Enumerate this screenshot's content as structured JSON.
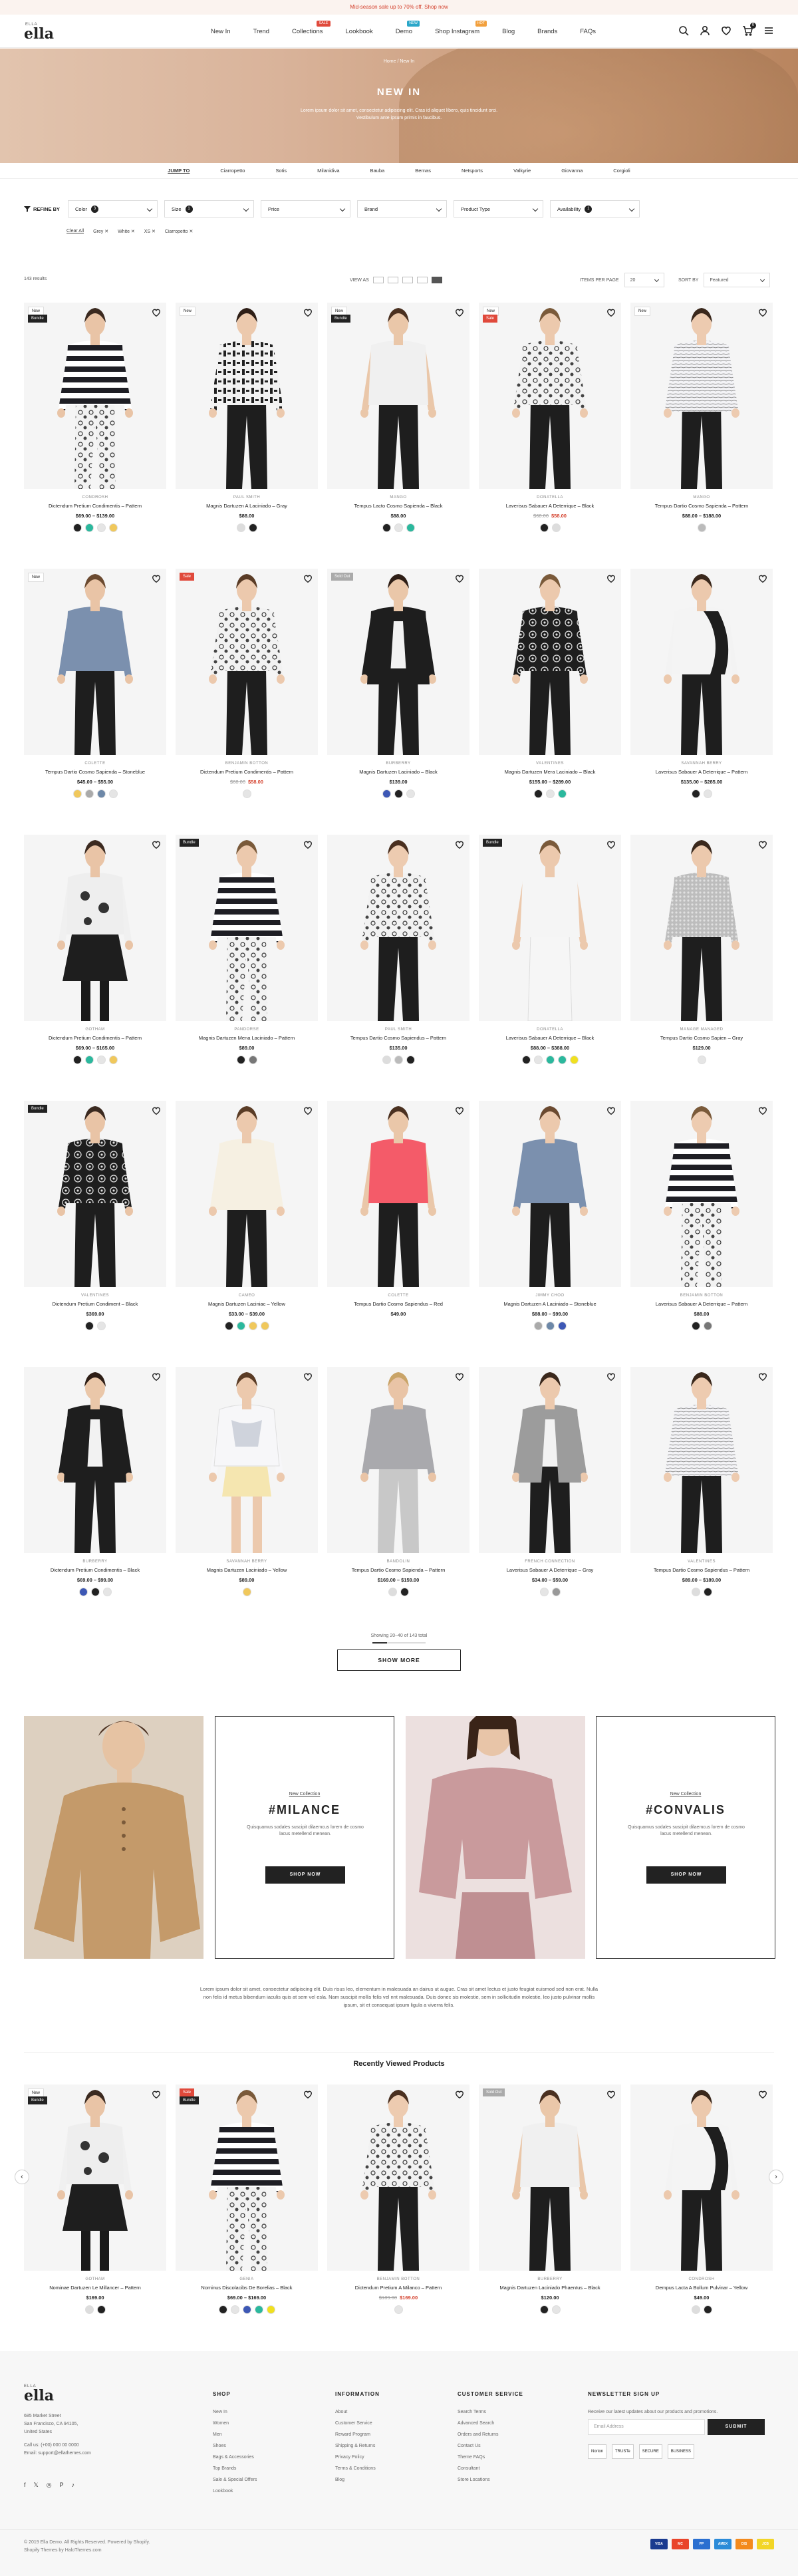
{
  "announcement": "Mid-season sale up to 70% off. Shop now",
  "header": {
    "logo_tag": "ELLA",
    "logo": "ella",
    "nav": [
      {
        "label": "New In",
        "badge": "",
        "color": ""
      },
      {
        "label": "Trend",
        "badge": "",
        "color": ""
      },
      {
        "label": "Collections",
        "badge": "SALE",
        "color": "#e0493b"
      },
      {
        "label": "Lookbook",
        "badge": "",
        "color": ""
      },
      {
        "label": "Demo",
        "badge": "NEW",
        "color": "#2aa7c9"
      },
      {
        "label": "Shop Instagram",
        "badge": "HOT",
        "color": "#f2a03d"
      },
      {
        "label": "Blog",
        "badge": "",
        "color": ""
      },
      {
        "label": "Brands",
        "badge": "",
        "color": ""
      },
      {
        "label": "FAQs",
        "badge": "",
        "color": ""
      }
    ],
    "cart_count": "0"
  },
  "hero": {
    "breadcrumb": "Home  /  New In",
    "title": "NEW IN",
    "description": "Lorem ipsum dolor sit amet, consectetur adipiscing elit. Cras id aliquet libero, quis tincidunt orci. Vestibulum ante ipsum primis in faucibus."
  },
  "subnav": [
    "JUMP TO",
    "Ciarropetto",
    "Sotis",
    "Milanidiva",
    "Bauba",
    "Bernas",
    "Netsports",
    "Valkyrie",
    "Giovanna",
    "Corgioli"
  ],
  "filters": {
    "refine": "REFINE BY",
    "dropdowns": [
      {
        "label": "Color",
        "count": "3"
      },
      {
        "label": "Size",
        "count": "1"
      },
      {
        "label": "Price",
        "count": ""
      },
      {
        "label": "Brand",
        "count": ""
      },
      {
        "label": "Product Type",
        "count": ""
      },
      {
        "label": "Availability",
        "count": "1"
      }
    ],
    "chips": [
      "Clear All",
      "Grey ✕",
      "White ✕",
      "XS ✕",
      "Ciarropetto ✕"
    ]
  },
  "toolbar": {
    "results": "143 results",
    "view_as": "VIEW AS",
    "items_per_page_label": "ITEMS PER PAGE",
    "items_per_page": "20",
    "sort_label": "SORT BY",
    "sort_value": "Featured"
  },
  "products": [
    {
      "vendor": "CONDROSH",
      "name": "Dictendum Pretium Condimentis – Pattern",
      "old": "",
      "price": "$69.00 – $139.00",
      "labels": [
        {
          "t": "New",
          "c": "#fff",
          "tc": "#222"
        },
        {
          "t": "Bundle",
          "c": "#222",
          "tc": "#fff"
        }
      ],
      "swatches": [
        "#222",
        "#2bb89d",
        "#e5e5e5",
        "#f0c85c"
      ],
      "outfit": {
        "top": "stripes",
        "bottom": "floral",
        "skin": "#e9c4a6",
        "hair": "#3b2a20"
      }
    },
    {
      "vendor": "PAUL SMITH",
      "name": "Magnis Dartuzen A Laciniado – Gray",
      "old": "",
      "price": "$88.00",
      "labels": [
        {
          "t": "New",
          "c": "#fff",
          "tc": "#222"
        }
      ],
      "swatches": [
        "#ddd",
        "#222"
      ],
      "outfit": {
        "top": "letters",
        "bottom": "black",
        "skin": "#ecc9ad",
        "hair": "#2e1e16"
      }
    },
    {
      "vendor": "MANGO",
      "name": "Tempus Lacto Cosmo Sapienda – Black",
      "old": "",
      "price": "$88.00",
      "labels": [
        {
          "t": "New",
          "c": "#fff",
          "tc": "#222"
        },
        {
          "t": "Bundle",
          "c": "#222",
          "tc": "#fff"
        }
      ],
      "swatches": [
        "#222",
        "#e5e5e5",
        "#2bb89d"
      ],
      "outfit": {
        "top": "sleeveless",
        "bottom": "black",
        "skin": "#eac7a9",
        "hair": "#4a3020"
      }
    },
    {
      "vendor": "DONATELLA",
      "name": "Laverisus Sabauer A Deterrique – Black",
      "old": "$68.00",
      "price": "$58.00",
      "labels": [
        {
          "t": "New",
          "c": "#fff",
          "tc": "#222"
        },
        {
          "t": "Sale",
          "c": "#e0493b",
          "tc": "#fff"
        }
      ],
      "swatches": [
        "#222",
        "#ddd"
      ],
      "outfit": {
        "top": "floral",
        "bottom": "black",
        "skin": "#ecc9ad",
        "hair": "#7a5a3a"
      }
    },
    {
      "vendor": "MANGO",
      "name": "Tempus Dartio Cosmo Sapienda – Pattern",
      "old": "",
      "price": "$88.00 – $188.00",
      "labels": [
        {
          "t": "New",
          "c": "#fff",
          "tc": "#222"
        }
      ],
      "swatches": [
        "#bbb"
      ],
      "outfit": {
        "top": "lines",
        "bottom": "black",
        "skin": "#edcbb0",
        "hair": "#3a281c"
      }
    },
    {
      "vendor": "COLETTE",
      "name": "Tempus Dartio Cosmo Sapienda – Stoneblue",
      "old": "",
      "price": "$45.00 – $55.00",
      "labels": [
        {
          "t": "New",
          "c": "#fff",
          "tc": "#222"
        }
      ],
      "swatches": [
        "#f0c85c",
        "#aaa",
        "#6d88a8",
        "#e5e5e5"
      ],
      "outfit": {
        "top": "denim",
        "bottom": "black",
        "skin": "#e9c4a6",
        "hair": "#6b4a30"
      }
    },
    {
      "vendor": "BENJAMIN BOTTON",
      "name": "Dictendum Pretium Condimentis – Pattern",
      "old": "$68.00",
      "price": "$58.00",
      "labels": [
        {
          "t": "Sale",
          "c": "#e0493b",
          "tc": "#fff"
        }
      ],
      "swatches": [
        "#e5e5e5"
      ],
      "outfit": {
        "top": "floral",
        "bottom": "black",
        "skin": "#ecc9ad",
        "hair": "#5a3c26"
      }
    },
    {
      "vendor": "BURBERRY",
      "name": "Magnis Dartuzen Laciniado – Black",
      "old": "",
      "price": "$139.00",
      "labels": [
        {
          "t": "Sold Out",
          "c": "#aaa",
          "tc": "#fff"
        }
      ],
      "swatches": [
        "#3d58b5",
        "#222",
        "#e5e5e5"
      ],
      "outfit": {
        "top": "cardigan",
        "bottom": "black",
        "skin": "#eac7a9",
        "hair": "#2e1e16"
      }
    },
    {
      "vendor": "VALENTINES",
      "name": "Magnis Dartuzen Mera Laciniado – Black",
      "old": "",
      "price": "$155.00 – $289.00",
      "labels": [],
      "swatches": [
        "#222",
        "#e5e5e5",
        "#2bb89d"
      ],
      "outfit": {
        "top": "baroque",
        "bottom": "black",
        "skin": "#ecc9ad",
        "hair": "#7a5a3a"
      }
    },
    {
      "vendor": "SAVANNAH BERRY",
      "name": "Laverisus Sabauer A Deterrique – Pattern",
      "old": "",
      "price": "$135.00 – $285.00",
      "labels": [],
      "swatches": [
        "#222",
        "#e5e5e5"
      ],
      "outfit": {
        "top": "bigprint",
        "bottom": "black",
        "skin": "#ecc9ad",
        "hair": "#3a281c"
      }
    },
    {
      "vendor": "GOTHAM",
      "name": "Dictendum Pretium Condimentis – Pattern",
      "old": "",
      "price": "$69.00 – $165.00",
      "labels": [],
      "swatches": [
        "#222",
        "#2bb89d",
        "#e5e5e5",
        "#f0c85c"
      ],
      "outfit": {
        "top": "printshort",
        "bottom": "skirt",
        "skin": "#e9c4a6",
        "hair": "#3b2a20"
      }
    },
    {
      "vendor": "PANDORSE",
      "name": "Magnis Dartuzen Mena Laciniado – Pattern",
      "old": "",
      "price": "$89.00",
      "labels": [
        {
          "t": "Bundle",
          "c": "#222",
          "tc": "#fff"
        }
      ],
      "swatches": [
        "#222",
        "#777"
      ],
      "outfit": {
        "top": "stripes",
        "bottom": "floral",
        "skin": "#ecc9ad",
        "hair": "#7a5a3a"
      }
    },
    {
      "vendor": "PAUL SMITH",
      "name": "Tempus Dartio Cosmo Sapiendus – Pattern",
      "old": "",
      "price": "$135.00",
      "labels": [],
      "swatches": [
        "#ddd",
        "#bbb",
        "#222"
      ],
      "outfit": {
        "top": "floral",
        "bottom": "black",
        "skin": "#edcbb0",
        "hair": "#4a3020"
      }
    },
    {
      "vendor": "DONATELLA",
      "name": "Laverisus Sabauer A Deterrique – Black",
      "old": "",
      "price": "$88.00 – $388.00",
      "labels": [
        {
          "t": "Bundle",
          "c": "#222",
          "tc": "#fff"
        }
      ],
      "swatches": [
        "#222",
        "#e5e5e5",
        "#2bb89d",
        "#2bb89d",
        "#f0e020"
      ],
      "outfit": {
        "top": "tank",
        "bottom": "white",
        "skin": "#ecc9ad",
        "hair": "#7a5a3a"
      }
    },
    {
      "vendor": "MANAGE MANAGED",
      "name": "Tempus Dartio Cosmo Sapien – Gray",
      "old": "",
      "price": "$129.00",
      "labels": [],
      "swatches": [
        "#e5e5e5"
      ],
      "outfit": {
        "top": "sequin",
        "bottom": "black",
        "skin": "#ecc9ad",
        "hair": "#3a281c"
      }
    },
    {
      "vendor": "VALENTINES",
      "name": "Dictendum Pretium Condiment – Black",
      "old": "",
      "price": "$369.00",
      "labels": [
        {
          "t": "Bundle",
          "c": "#222",
          "tc": "#fff"
        }
      ],
      "swatches": [
        "#222",
        "#e5e5e5"
      ],
      "outfit": {
        "top": "baroque",
        "bottom": "black",
        "skin": "#e9c4a6",
        "hair": "#3b2a20"
      }
    },
    {
      "vendor": "CAMEO",
      "name": "Magnis Dartuzen Laciniac – Yellow",
      "old": "",
      "price": "$33.00 – $39.00",
      "labels": [],
      "swatches": [
        "#222",
        "#2bb89d",
        "#f0c85c",
        "#f0c85c"
      ],
      "outfit": {
        "top": "cream",
        "bottom": "black",
        "skin": "#ecc9ad",
        "hair": "#5a3c26"
      }
    },
    {
      "vendor": "COLETTE",
      "name": "Tempus Dartio Cosmo Sapiendus – Red",
      "old": "",
      "price": "$49.00",
      "labels": [],
      "swatches": [],
      "outfit": {
        "top": "coral",
        "bottom": "black",
        "skin": "#eac7a9",
        "hair": "#4a3020"
      }
    },
    {
      "vendor": "JIMMY CHOO",
      "name": "Magnis Dartuzen A Laciniado – Stoneblue",
      "old": "",
      "price": "$88.00 – $99.00",
      "labels": [],
      "swatches": [
        "#aaa",
        "#6d88a8",
        "#3d58b5"
      ],
      "outfit": {
        "top": "denim",
        "bottom": "black",
        "skin": "#ecc9ad",
        "hair": "#6b4a30"
      }
    },
    {
      "vendor": "BENJAMIN BOTTON",
      "name": "Laverisus Sabauer A Deterrique – Pattern",
      "old": "",
      "price": "$88.00",
      "labels": [],
      "swatches": [
        "#222",
        "#777"
      ],
      "outfit": {
        "top": "stripes",
        "bottom": "floral",
        "skin": "#edcbb0",
        "hair": "#7a5a3a"
      }
    },
    {
      "vendor": "BURBERRY",
      "name": "Dictendum Pretium Condimentis – Black",
      "old": "",
      "price": "$69.00 – $99.00",
      "labels": [],
      "swatches": [
        "#3d58b5",
        "#222",
        "#e5e5e5"
      ],
      "outfit": {
        "top": "cardigan",
        "bottom": "black",
        "skin": "#eac7a9",
        "hair": "#2e1e16"
      }
    },
    {
      "vendor": "SAVANNAH BERRY",
      "name": "Magnis Dartuzen Laciniado – Yellow",
      "old": "",
      "price": "$89.00",
      "labels": [],
      "swatches": [
        "#f0c85c"
      ],
      "outfit": {
        "top": "tie",
        "bottom": "shorts",
        "skin": "#ecc9ad",
        "hair": "#5a3c26"
      }
    },
    {
      "vendor": "BANDOLIN",
      "name": "Tempus Dartio Cosmo Sapienda – Pattern",
      "old": "",
      "price": "$169.00 – $159.00",
      "labels": [],
      "swatches": [
        "#ddd",
        "#222"
      ],
      "outfit": {
        "top": "greyback",
        "bottom": "greypant",
        "skin": "#e9c4a6",
        "hair": "#c9a468"
      }
    },
    {
      "vendor": "FRENCH CONNECTION",
      "name": "Laverisus Sabauer A Deterrique – Gray",
      "old": "",
      "price": "$34.00 – $59.00",
      "labels": [],
      "swatches": [
        "#e5e5e5",
        "#999"
      ],
      "outfit": {
        "top": "drape",
        "bottom": "black",
        "skin": "#ecc9ad",
        "hair": "#3a281c"
      }
    },
    {
      "vendor": "VALENTINES",
      "name": "Tempus Dartio Cosmo Sapiendus – Pattern",
      "old": "",
      "price": "$89.00 – $189.00",
      "labels": [],
      "swatches": [
        "#ddd",
        "#222"
      ],
      "outfit": {
        "top": "lines",
        "bottom": "black",
        "skin": "#edcbb0",
        "hair": "#3a281c"
      }
    }
  ],
  "pagination": {
    "showing": "Showing 20–40 of 143 total",
    "progress": 0.28,
    "button": "SHOW MORE"
  },
  "collections": [
    {
      "sub": "New Collection",
      "title": "#MILANCE",
      "desc": "Quisquamus sodales suscipit dilaemcus lorem de cosmo lacus metellend menean.",
      "button": "SHOP NOW"
    },
    {
      "sub": "New Collection",
      "title": "#CONVALIS",
      "desc": "Quisquamus sodales suscipit dilaemcus lorem de cosmo lacus metellend menean.",
      "button": "SHOP NOW"
    }
  ],
  "paragraph": "Lorem ipsum dolor sit amet, consectetur adipiscing elit. Duis risus leo, elementum in malesuada an dairus ut augue. Cras sit amet lectus et justo feugiat euismod sed non erat. Nulla non felis id metus bibendum iaculis quis at sem vel esla. Nam suscipit mollis felis vel nnt malesuada. Duis donec sis molestie, sem in sollicitudin molestie, leo justo pulvinar mollis ipsum, sit et consequat ipsum ligula a viverra felis.",
  "recently_viewed": {
    "title": "Recently Viewed Products",
    "items": [
      {
        "vendor": "GOTHAM",
        "name": "Nominae Dartuzen Le Millancer – Pattern",
        "old": "",
        "price": "$169.00",
        "labels": [
          {
            "t": "New",
            "c": "#fff",
            "tc": "#222"
          },
          {
            "t": "Bundle",
            "c": "#222",
            "tc": "#fff"
          }
        ],
        "swatches": [
          "#ddd",
          "#222"
        ],
        "outfit": {
          "top": "printshort",
          "bottom": "skirt",
          "skin": "#e9c4a6",
          "hair": "#3b2a20"
        }
      },
      {
        "vendor": "GENIA",
        "name": "Nominus Discolacibs De Borelias – Black",
        "old": "",
        "price": "$69.00 – $169.00",
        "labels": [
          {
            "t": "Sale",
            "c": "#e0493b",
            "tc": "#fff"
          },
          {
            "t": "Bundle",
            "c": "#222",
            "tc": "#fff"
          }
        ],
        "swatches": [
          "#222",
          "#e5e5e5",
          "#3d58b5",
          "#2bb89d",
          "#f0e020"
        ],
        "outfit": {
          "top": "stripes",
          "bottom": "floral",
          "skin": "#ecc9ad",
          "hair": "#7a5a3a"
        }
      },
      {
        "vendor": "BENJAMIN BOTTON",
        "name": "Dictendum Pretium A Milanco – Pattern",
        "old": "$189.00",
        "price": "$169.00",
        "labels": [],
        "swatches": [
          "#e5e5e5"
        ],
        "outfit": {
          "top": "floral",
          "bottom": "black",
          "skin": "#edcbb0",
          "hair": "#4a3020"
        }
      },
      {
        "vendor": "BURBERRY",
        "name": "Magnis Dartuzen Laciniado Phaentus – Black",
        "old": "",
        "price": "$120.00",
        "labels": [
          {
            "t": "Sold Out",
            "c": "#aaa",
            "tc": "#fff"
          }
        ],
        "swatches": [
          "#222",
          "#e5e5e5"
        ],
        "outfit": {
          "top": "sleeveless",
          "bottom": "black",
          "skin": "#eac7a9",
          "hair": "#4a3020"
        }
      },
      {
        "vendor": "CONDROSH",
        "name": "Dempus Lacta A Bollum Pulvinar – Yellow",
        "old": "",
        "price": "$49.00",
        "labels": [],
        "swatches": [
          "#ddd",
          "#222"
        ],
        "outfit": {
          "top": "bigprint",
          "bottom": "black",
          "skin": "#ecc9ad",
          "hair": "#3a281c"
        }
      }
    ]
  },
  "footer": {
    "logo_tag": "ELLA",
    "logo": "ella",
    "address": [
      "685 Market Street",
      "San Francisco, CA 94105,",
      "United States"
    ],
    "contact": [
      "Call us: (+00) 000 00 0000",
      "Email: support@ellathemes.com"
    ],
    "columns": [
      {
        "title": "SHOP",
        "links": [
          "New In",
          "Women",
          "Men",
          "Shoes",
          "Bags & Accessories",
          "Top Brands",
          "Sale & Special Offers",
          "Lookbook"
        ]
      },
      {
        "title": "INFORMATION",
        "links": [
          "About",
          "Customer Service",
          "Reward Program",
          "Shipping & Returns",
          "Privacy Policy",
          "Terms & Conditions",
          "Blog"
        ]
      },
      {
        "title": "CUSTOMER SERVICE",
        "links": [
          "Search Terms",
          "Advanced Search",
          "Orders and Returns",
          "Contact Us",
          "Theme FAQs",
          "Consultant",
          "Store Locations"
        ]
      }
    ],
    "newsletter_title": "NEWSLETTER SIGN UP",
    "newsletter_desc": "Receive our latest updates about our products and promotions.",
    "email_placeholder": "Email Address",
    "submit": "SUBMIT",
    "trust_badges": [
      "Norton",
      "TRUSTe",
      "SECURE",
      "BUSINESS"
    ],
    "social": [
      "f",
      "𝕏",
      "◎",
      "P",
      "♪"
    ],
    "copyright": "© 2019 Ella Demo. All Rights Reserved. Powered by Shopify.",
    "credit": "Shopify Themes by HaloThemes.com",
    "payments": [
      {
        "name": "VISA",
        "color": "#1a3a8f"
      },
      {
        "name": "MC",
        "color": "#e9442a"
      },
      {
        "name": "PP",
        "color": "#2a6fd0"
      },
      {
        "name": "AMEX",
        "color": "#2b8bd8"
      },
      {
        "name": "DIS",
        "color": "#f38a1d"
      },
      {
        "name": "JCB",
        "color": "#f2d526"
      }
    ]
  }
}
